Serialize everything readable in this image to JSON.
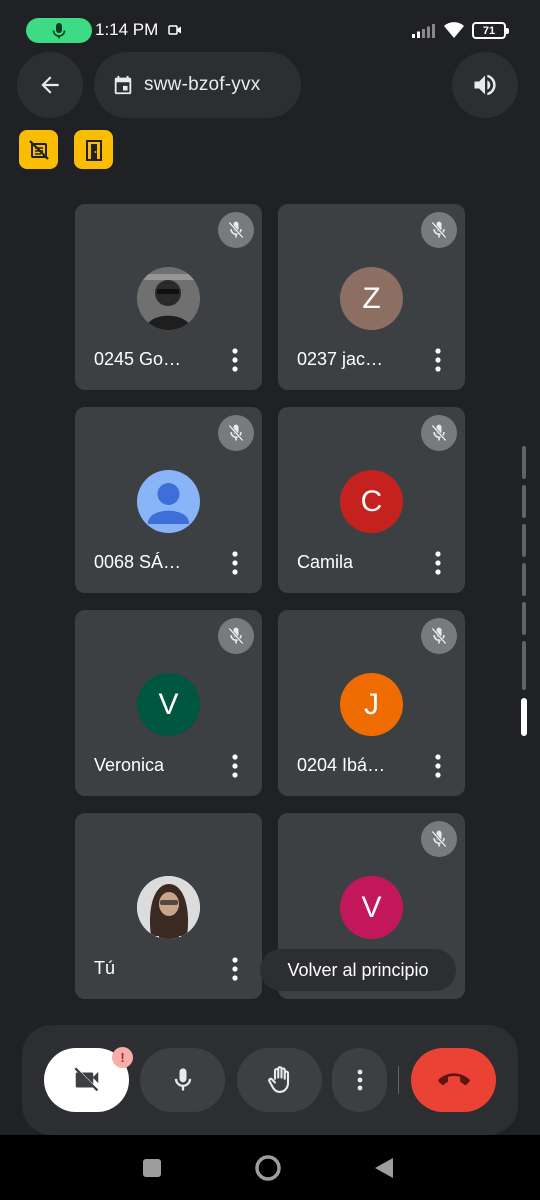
{
  "status_bar": {
    "time": "1:14 PM",
    "battery": "71"
  },
  "header": {
    "meeting_code": "sww-bzof-yvx",
    "icons": [
      "back-arrow-icon",
      "calendar-icon",
      "speaker-icon"
    ]
  },
  "badges": [
    "hand-off-icon",
    "door-icon"
  ],
  "participants": [
    {
      "name": "0245 Go…",
      "avatar_type": "photo",
      "muted": true
    },
    {
      "name": "0237 jac…",
      "avatar_type": "letter",
      "initial": "Z",
      "color": "#8d6e63",
      "muted": true
    },
    {
      "name": "0068 SÁ…",
      "avatar_type": "default",
      "color": "#8ab4f8",
      "muted": true
    },
    {
      "name": "Camila",
      "avatar_type": "letter",
      "initial": "C",
      "color": "#c5221f",
      "muted": true
    },
    {
      "name": "Veronica",
      "avatar_type": "letter",
      "initial": "V",
      "color": "#00573f",
      "muted": true
    },
    {
      "name": "0204 Ibá…",
      "avatar_type": "letter",
      "initial": "J",
      "color": "#ef6c00",
      "muted": true
    },
    {
      "name": "Tú",
      "avatar_type": "photo",
      "muted": false
    },
    {
      "name": "",
      "avatar_type": "letter",
      "initial": "V",
      "color": "#c2185b",
      "muted": true
    }
  ],
  "tooltip": "Volver al principio",
  "controls": {
    "alert": "!",
    "icons": [
      "camera-off-icon",
      "mic-icon",
      "raise-hand-icon",
      "more-vert-icon",
      "end-call-icon"
    ]
  },
  "colors": {
    "background": "#202124",
    "tile": "#3c4043",
    "end_call": "#ea4335",
    "badge": "#fbbc04",
    "mic_active": "#3ddc84"
  }
}
